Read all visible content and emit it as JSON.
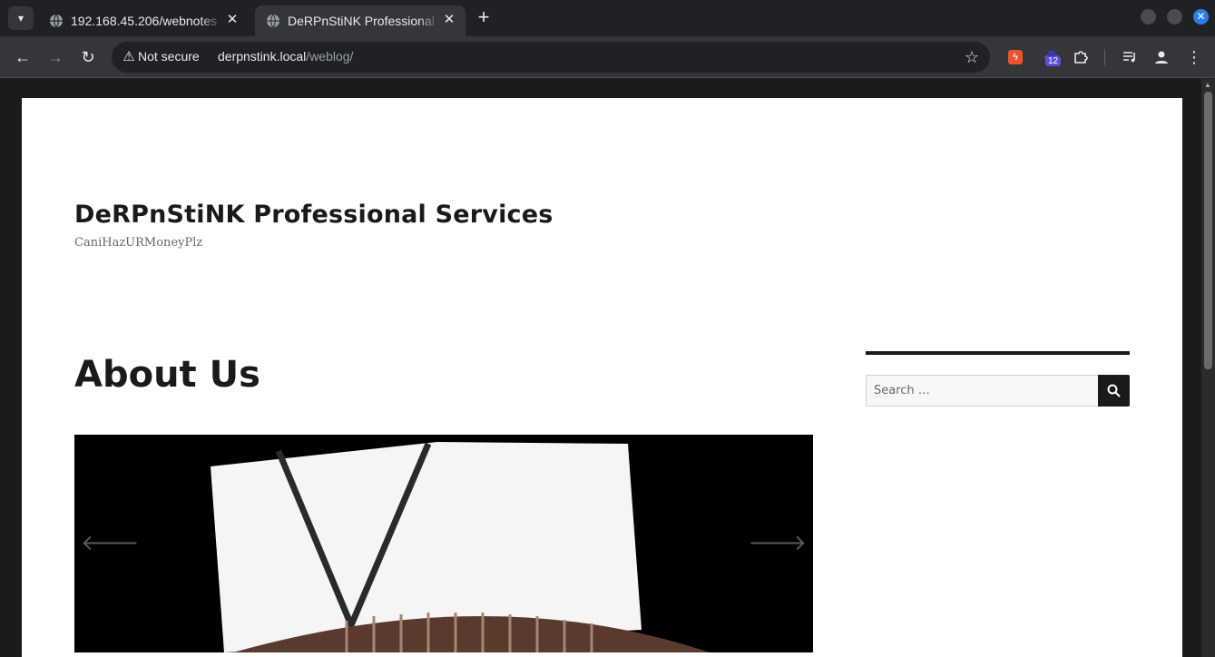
{
  "browser": {
    "tabs": [
      {
        "title": "192.168.45.206/webnotes",
        "active": false
      },
      {
        "title": "DeRPnStiNK Professional Services",
        "active": true
      }
    ],
    "address_bar": {
      "security_label": "Not secure",
      "url_host": "derpnstink.local",
      "url_path": "/weblog/"
    },
    "extensions": {
      "badge_count": "12"
    },
    "icons": [
      "tab-list-icon",
      "globe-icon",
      "close-icon",
      "plus-icon",
      "back-icon",
      "forward-icon",
      "reload-icon",
      "warning-icon",
      "star-icon",
      "extension-icon",
      "puzzle-icon",
      "media-icon",
      "profile-icon",
      "menu-icon"
    ]
  },
  "site": {
    "title": "DeRPnStiNK Professional Services",
    "description": "CaniHazURMoneyPlz",
    "page_title": "About Us",
    "search": {
      "placeholder": "Search …"
    }
  },
  "colors": {
    "browser_bg": "#202124",
    "toolbar_bg": "#35363a",
    "page_bg": "#ffffff",
    "text_dark": "#1a1a1a",
    "ext_orange": "#e8552c",
    "badge_purple": "#5b4fd6"
  }
}
